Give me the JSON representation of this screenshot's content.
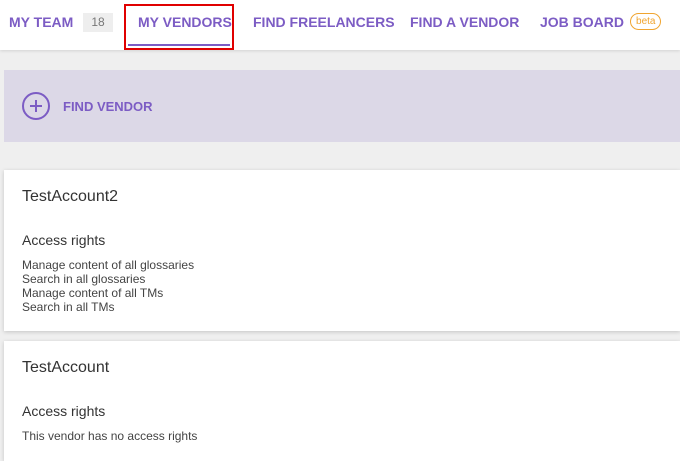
{
  "nav": {
    "tabs": [
      {
        "label": "MY TEAM",
        "count": "18"
      },
      {
        "label": "MY VENDORS"
      },
      {
        "label": "FIND FREELANCERS"
      },
      {
        "label": "FIND A VENDOR"
      },
      {
        "label": "JOB BOARD",
        "badge": "beta"
      }
    ],
    "active_tab": "MY VENDORS"
  },
  "find_vendor": {
    "label": "FIND VENDOR",
    "icon": "plus-circle-icon"
  },
  "vendors": [
    {
      "name": "TestAccount2",
      "rights_title": "Access rights",
      "rights": [
        "Manage content of all glossaries",
        "Search in all glossaries",
        "Manage content of all TMs",
        "Search in all TMs"
      ]
    },
    {
      "name": "TestAccount",
      "rights_title": "Access rights",
      "rights": [
        "This vendor has no access rights"
      ]
    }
  ],
  "colors": {
    "accent": "#7c5cc4",
    "highlight_box": "#e00000",
    "beta_badge": "#f0a530",
    "find_vendor_bg": "#dcd8e7"
  }
}
